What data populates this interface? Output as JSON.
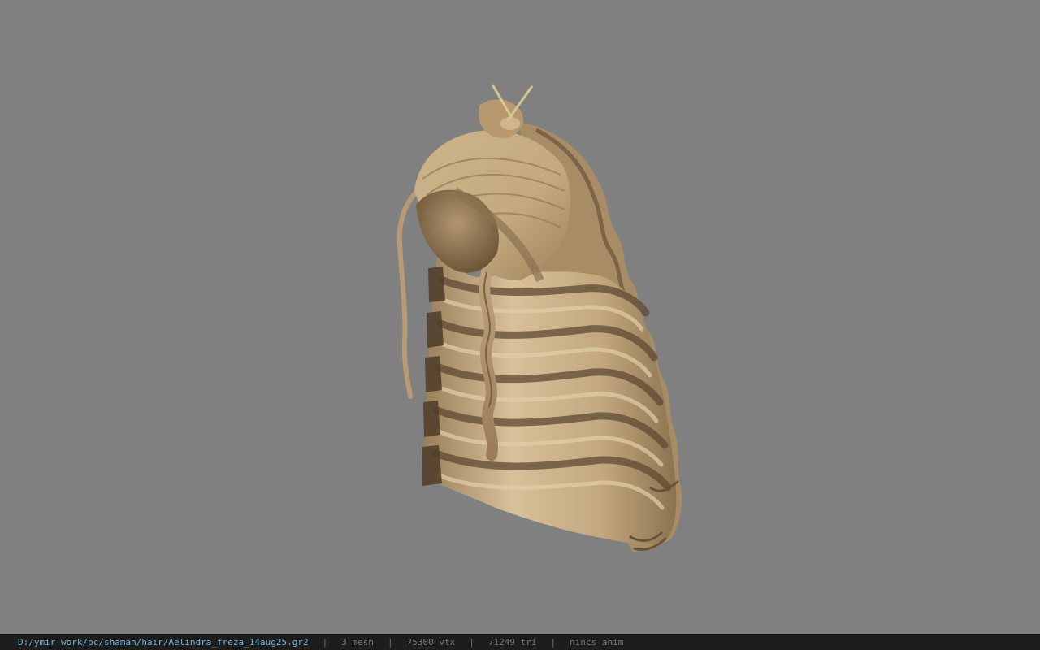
{
  "viewer": {
    "background": "#808080",
    "model_colors": {
      "light": "#dcc49c",
      "mid": "#b99c72",
      "dark": "#5a4630",
      "stick": "#d8c690"
    }
  },
  "status_bar": {
    "file_path": "D:/ymir work/pc/shaman/hair/Aelindra_freza_14aug25.gr2",
    "separator": "|",
    "mesh_count": "3 mesh",
    "vertex_count": "75300 vtx",
    "triangle_count": "71249 tri",
    "anim_status": "nincs anim",
    "colors": {
      "path": "#73b3d8",
      "info": "#7a7a7a",
      "background": "#1d1d1d"
    }
  }
}
